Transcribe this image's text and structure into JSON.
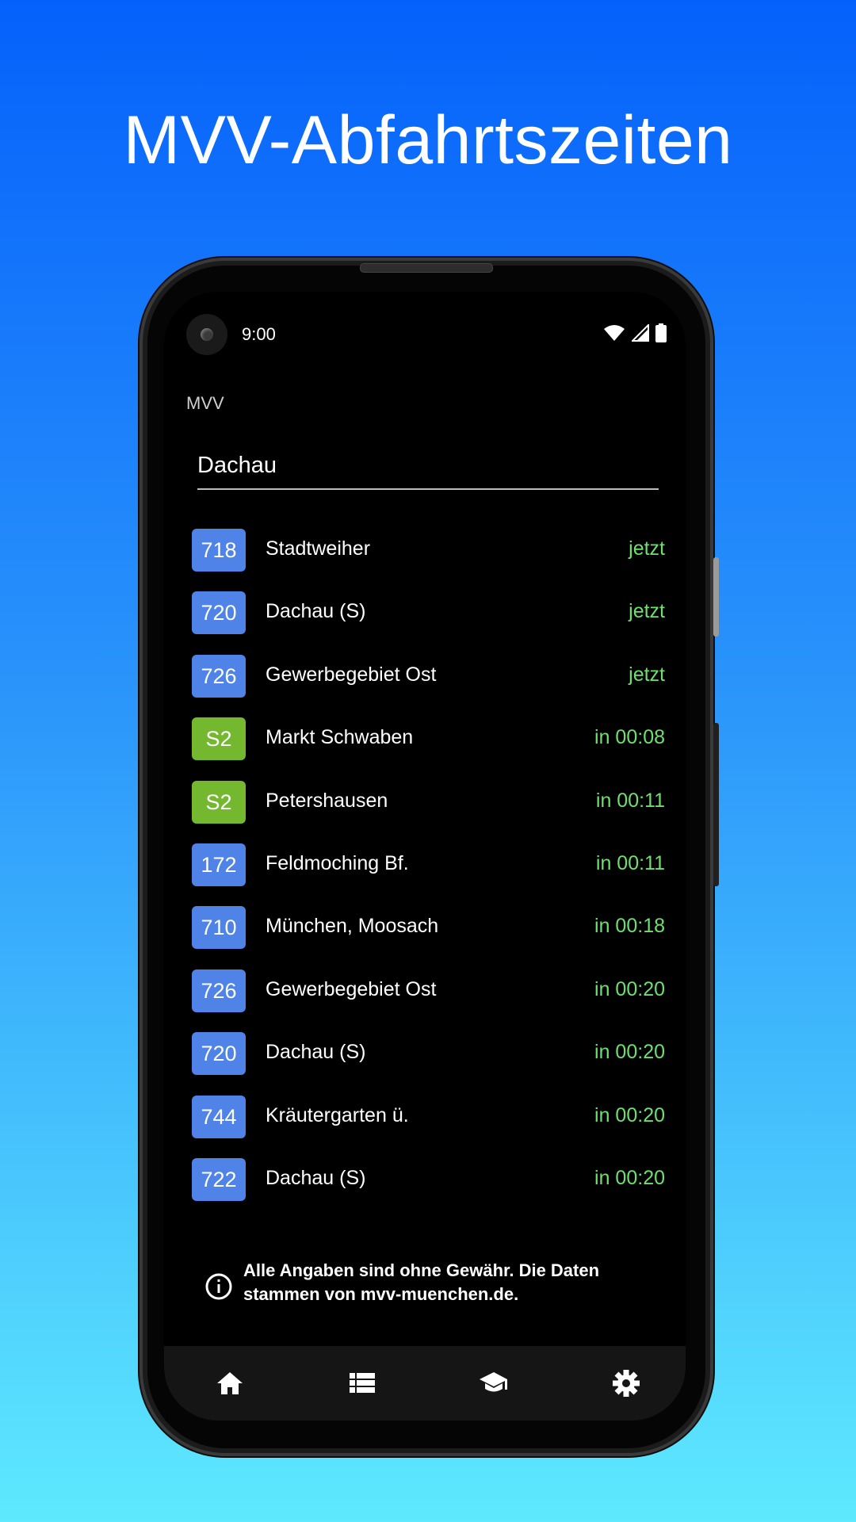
{
  "headline": "MVV-Abfahrtszeiten",
  "colors": {
    "bus_badge": "#4f83e8",
    "sbahn_badge": "#74b82f",
    "time_text": "#6de06d"
  },
  "status_bar": {
    "time": "9:00",
    "icons": [
      "wifi-icon",
      "signal-icon",
      "battery-icon"
    ]
  },
  "app": {
    "title": "MVV"
  },
  "search": {
    "value": "Dachau"
  },
  "departures": [
    {
      "line": "718",
      "type": "bus",
      "destination": "Stadtweiher",
      "time": "jetzt"
    },
    {
      "line": "720",
      "type": "bus",
      "destination": "Dachau (S)",
      "time": "jetzt"
    },
    {
      "line": "726",
      "type": "bus",
      "destination": "Gewerbegebiet Ost",
      "time": "jetzt"
    },
    {
      "line": "S2",
      "type": "sbahn",
      "destination": "Markt Schwaben",
      "time": "in 00:08"
    },
    {
      "line": "S2",
      "type": "sbahn",
      "destination": "Petershausen",
      "time": "in 00:11"
    },
    {
      "line": "172",
      "type": "bus",
      "destination": "Feldmoching Bf.",
      "time": "in 00:11"
    },
    {
      "line": "710",
      "type": "bus",
      "destination": "München, Moosach",
      "time": "in 00:18"
    },
    {
      "line": "726",
      "type": "bus",
      "destination": "Gewerbegebiet Ost",
      "time": "in 00:20"
    },
    {
      "line": "720",
      "type": "bus",
      "destination": "Dachau (S)",
      "time": "in 00:20"
    },
    {
      "line": "744",
      "type": "bus",
      "destination": "Kräutergarten ü.",
      "time": "in 00:20"
    },
    {
      "line": "722",
      "type": "bus",
      "destination": "Dachau (S)",
      "time": "in 00:20"
    }
  ],
  "notice": {
    "text": "Alle Angaben sind ohne Gewähr. Die Daten stammen von mvv-muenchen.de.",
    "icon": "info-icon"
  },
  "bottom_nav": {
    "items": [
      {
        "icon": "home-icon"
      },
      {
        "icon": "list-icon"
      },
      {
        "icon": "school-icon"
      },
      {
        "icon": "settings-icon"
      }
    ]
  }
}
